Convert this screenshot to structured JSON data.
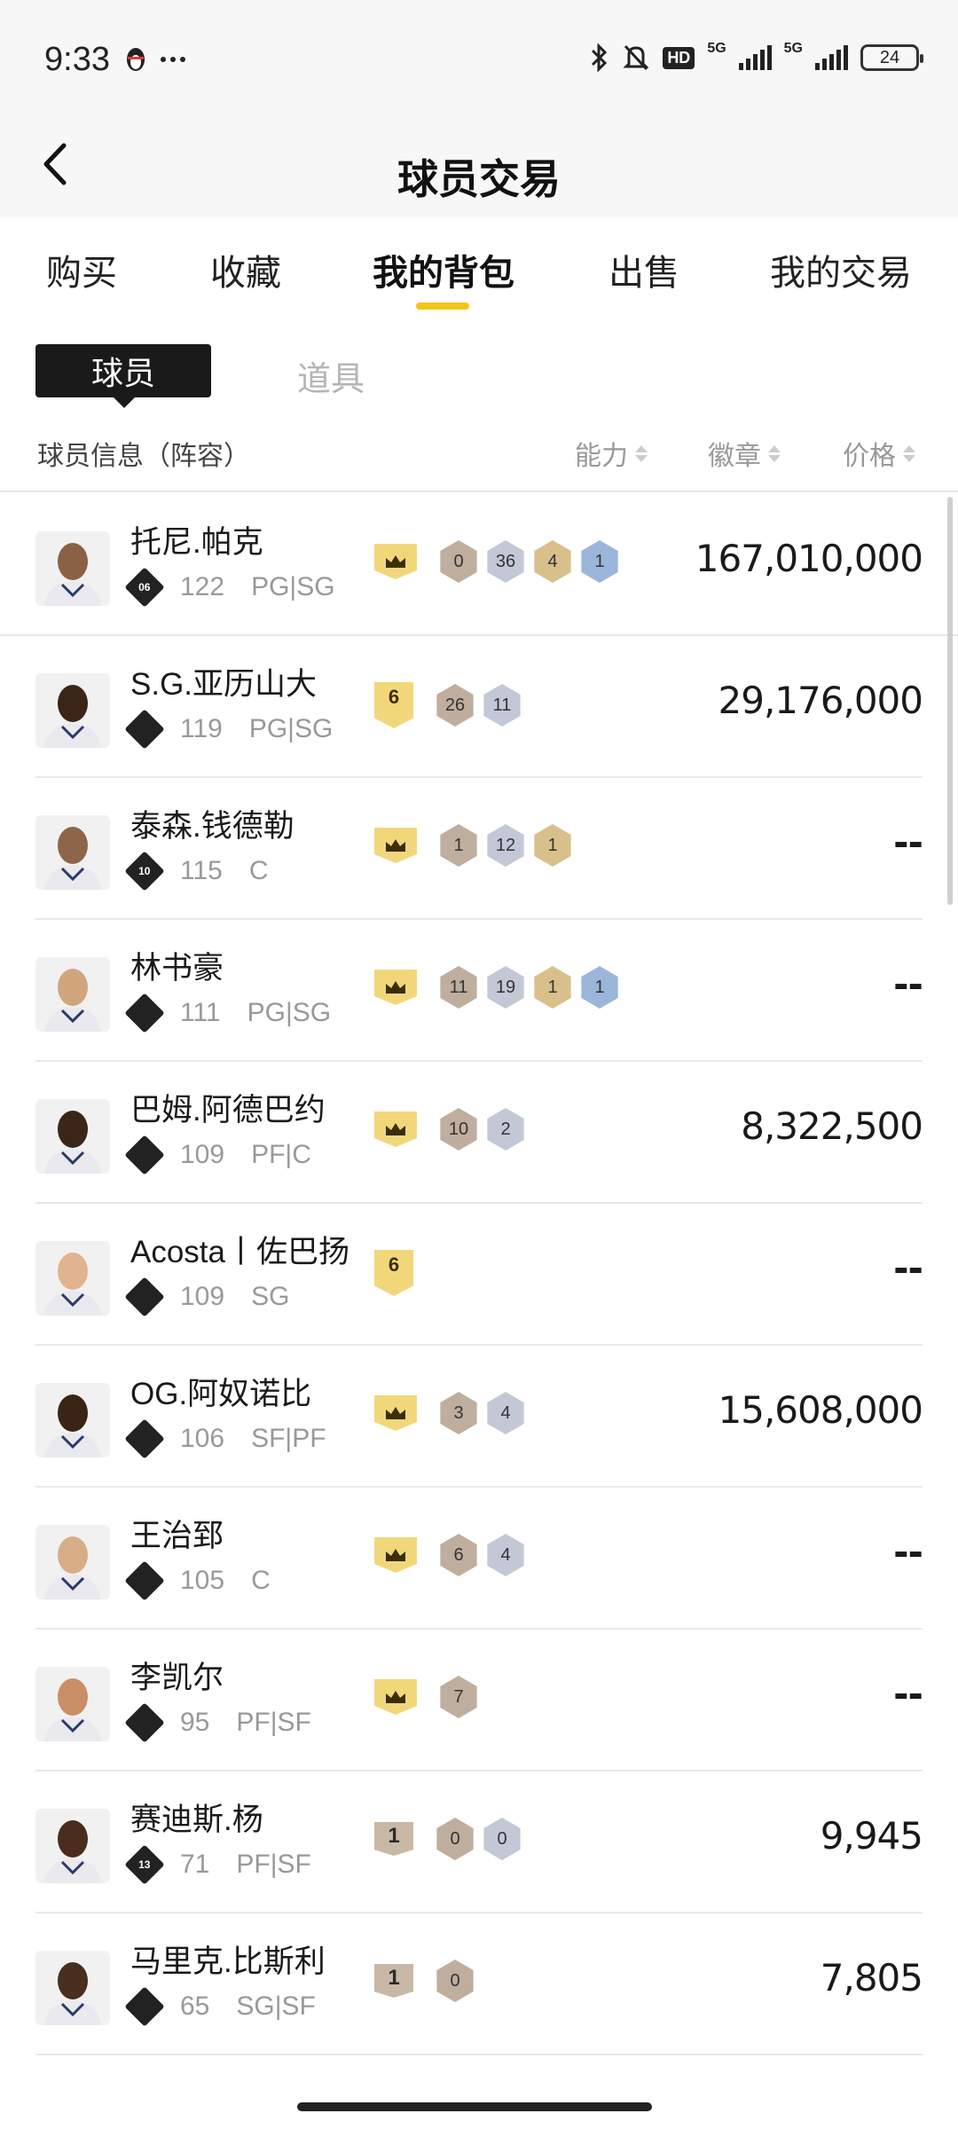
{
  "status": {
    "time": "9:33",
    "battery": "24",
    "hd": "HD",
    "net1": "5G",
    "net2": "5G"
  },
  "header": {
    "title": "球员交易"
  },
  "tabs": [
    {
      "label": "购买"
    },
    {
      "label": "收藏"
    },
    {
      "label": "我的背包"
    },
    {
      "label": "出售"
    },
    {
      "label": "我的交易"
    }
  ],
  "subtabs": {
    "active": "球员",
    "other": "道具"
  },
  "columns": {
    "info": "球员信息（阵容）",
    "ability": "能力",
    "badge": "徽章",
    "price": "价格"
  },
  "players": [
    {
      "name": "托尼.帕克",
      "lineup": "06",
      "score": "122",
      "pos": "PG|SG",
      "tier": "crown",
      "badges": [
        {
          "t": "bronze",
          "v": "0"
        },
        {
          "t": "silver",
          "v": "36"
        },
        {
          "t": "gold",
          "v": "4"
        },
        {
          "t": "blue",
          "v": "1"
        }
      ],
      "price": "167,010,000"
    },
    {
      "name": "S.G.亚历山大",
      "lineup": "",
      "score": "119",
      "pos": "PG|SG",
      "tier": "6",
      "badges": [
        {
          "t": "bronze",
          "v": "26"
        },
        {
          "t": "silver",
          "v": "11"
        }
      ],
      "price": "29,176,000"
    },
    {
      "name": "泰森.钱德勒",
      "lineup": "10",
      "score": "115",
      "pos": "C",
      "tier": "crown",
      "badges": [
        {
          "t": "bronze",
          "v": "1"
        },
        {
          "t": "silver",
          "v": "12"
        },
        {
          "t": "gold",
          "v": "1"
        }
      ],
      "price": "--"
    },
    {
      "name": "林书豪",
      "lineup": "",
      "score": "111",
      "pos": "PG|SG",
      "tier": "crown",
      "badges": [
        {
          "t": "bronze",
          "v": "11"
        },
        {
          "t": "silver",
          "v": "19"
        },
        {
          "t": "gold",
          "v": "1"
        },
        {
          "t": "blue",
          "v": "1"
        }
      ],
      "price": "--"
    },
    {
      "name": "巴姆.阿德巴约",
      "lineup": "",
      "score": "109",
      "pos": "PF|C",
      "tier": "crown",
      "badges": [
        {
          "t": "bronze",
          "v": "10"
        },
        {
          "t": "silver",
          "v": "2"
        }
      ],
      "price": "8,322,500"
    },
    {
      "name": "Acosta丨佐巴扬",
      "lineup": "",
      "score": "109",
      "pos": "SG",
      "tier": "6",
      "badges": [],
      "price": "--"
    },
    {
      "name": "OG.阿奴诺比",
      "lineup": "",
      "score": "106",
      "pos": "SF|PF",
      "tier": "crown",
      "badges": [
        {
          "t": "bronze",
          "v": "3"
        },
        {
          "t": "silver",
          "v": "4"
        }
      ],
      "price": "15,608,000"
    },
    {
      "name": "王治郅",
      "lineup": "",
      "score": "105",
      "pos": "C",
      "tier": "crown",
      "badges": [
        {
          "t": "bronze",
          "v": "6"
        },
        {
          "t": "silver",
          "v": "4"
        }
      ],
      "price": "--"
    },
    {
      "name": "李凯尔",
      "lineup": "",
      "score": "95",
      "pos": "PF|SF",
      "tier": "crown",
      "badges": [
        {
          "t": "bronze",
          "v": "7"
        }
      ],
      "price": "--"
    },
    {
      "name": "赛迪斯.杨",
      "lineup": "13",
      "score": "71",
      "pos": "PF|SF",
      "tier": "1",
      "badges": [
        {
          "t": "bronze",
          "v": "0"
        },
        {
          "t": "silver",
          "v": "0"
        }
      ],
      "price": "9,945"
    },
    {
      "name": "马里克.比斯利",
      "lineup": "",
      "score": "65",
      "pos": "SG|SF",
      "tier": "1",
      "badges": [
        {
          "t": "bronze",
          "v": "0"
        }
      ],
      "price": "7,805"
    }
  ],
  "colors": {
    "accent": "#f5c518",
    "text": "#1a1a1a",
    "muted": "#999999"
  }
}
